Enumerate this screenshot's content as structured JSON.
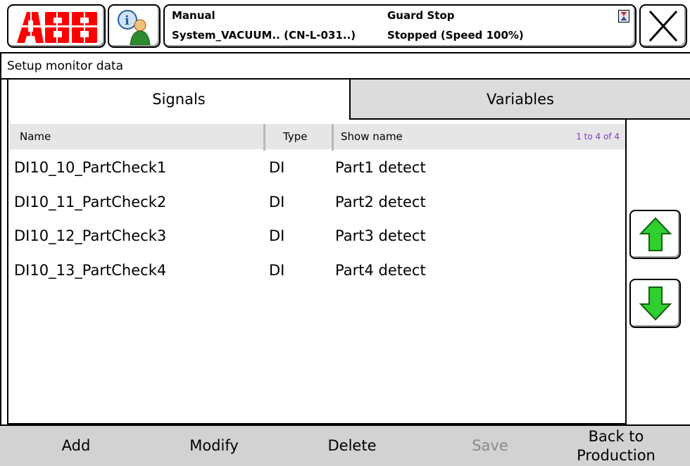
{
  "status": {
    "mode": "Manual",
    "system": "System_VACUUM.. (CN-L-031..)",
    "guard": "Guard Stop",
    "state": "Stopped (Speed 100%)"
  },
  "page": {
    "title": "Setup monitor data"
  },
  "tabs": [
    {
      "label": "Signals",
      "selected": true
    },
    {
      "label": "Variables",
      "selected": false
    }
  ],
  "table": {
    "columns": {
      "name": "Name",
      "type": "Type",
      "show_name": "Show name"
    },
    "count": "1 to 4 of 4",
    "rows": [
      {
        "name": "DI10_10_PartCheck1",
        "type": "DI",
        "show_name": "Part1 detect"
      },
      {
        "name": "DI10_11_PartCheck2",
        "type": "DI",
        "show_name": "Part2 detect"
      },
      {
        "name": "DI10_12_PartCheck3",
        "type": "DI",
        "show_name": "Part3 detect"
      },
      {
        "name": "DI10_13_PartCheck4",
        "type": "DI",
        "show_name": "Part4 detect"
      }
    ]
  },
  "commands": {
    "add": "Add",
    "modify": "Modify",
    "delete": "Delete",
    "save": "Save",
    "back_line1": "Back to",
    "back_line2": "Production"
  },
  "icons": {
    "logo": "ABB",
    "info": "info-person-icon",
    "status": "hourglass-icon",
    "close": "close-icon",
    "up": "up-arrow-icon",
    "down": "down-arrow-icon"
  },
  "colors": {
    "logo_red": "#ff0000",
    "arrow_green": "#2fcf2f",
    "tab_inactive": "#dcdcdc",
    "cmd_bar": "#d2d2d2",
    "count_purple": "#7a3fc9"
  }
}
